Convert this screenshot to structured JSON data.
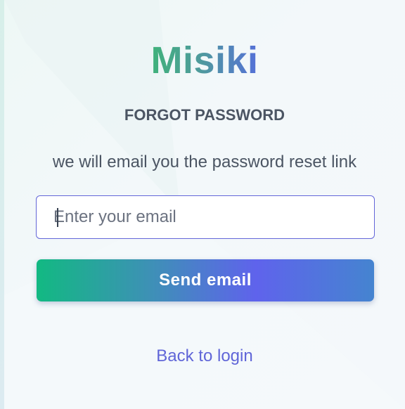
{
  "brand": {
    "name": "Misiki"
  },
  "form": {
    "heading": "FORGOT PASSWORD",
    "description": "we will email you the password reset link",
    "email_placeholder": "Enter your email",
    "email_value": "",
    "submit_label": "Send email",
    "back_link_label": "Back to login"
  },
  "colors": {
    "accent_green": "#12b982",
    "accent_indigo": "#5f63ec",
    "input_border": "#6366d8",
    "link": "#6066d8",
    "text": "#4b5563"
  }
}
